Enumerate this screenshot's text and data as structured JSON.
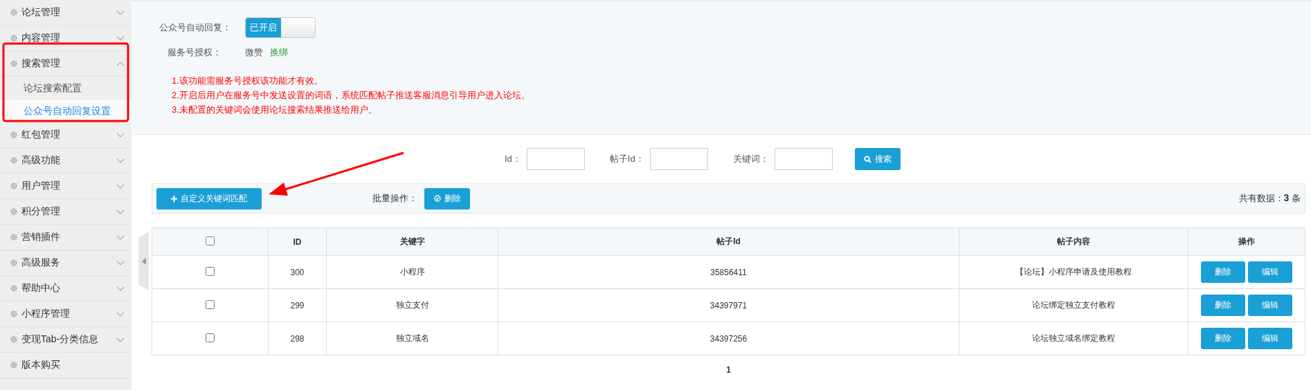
{
  "sidebar": {
    "items": [
      {
        "kind": "menu",
        "label": "论坛管理",
        "expanded": false
      },
      {
        "kind": "menu",
        "label": "内容管理",
        "expanded": false
      },
      {
        "kind": "menu",
        "label": "搜索管理",
        "expanded": true,
        "children": [
          {
            "label": "论坛搜索配置",
            "selected": false
          },
          {
            "label": "公众号自动回复设置",
            "selected": true
          }
        ]
      },
      {
        "kind": "menu",
        "label": "红包管理",
        "expanded": false
      },
      {
        "kind": "menu",
        "label": "高级功能",
        "expanded": false
      },
      {
        "kind": "menu",
        "label": "用户管理",
        "expanded": false
      },
      {
        "kind": "menu",
        "label": "积分管理",
        "expanded": false
      },
      {
        "kind": "menu",
        "label": "营销插件",
        "expanded": false
      },
      {
        "kind": "menu",
        "label": "高级服务",
        "expanded": false
      },
      {
        "kind": "menu",
        "label": "帮助中心",
        "expanded": false
      },
      {
        "kind": "menu",
        "label": "小程序管理",
        "expanded": false
      },
      {
        "kind": "menu",
        "label": "变现Tab-分类信息",
        "expanded": false
      },
      {
        "kind": "link",
        "label": "版本购买"
      }
    ]
  },
  "settings": {
    "auto_reply": {
      "label": "公众号自动回复：",
      "toggle": {
        "text": "已开启",
        "on": true
      }
    },
    "authorization": {
      "label": "服务号授权：",
      "value": "微赞",
      "link": "换绑"
    },
    "notes": [
      "1.该功能需服务号授权该功能才有效。",
      "2.开启后用户在服务号中发送设置的词语，系统匹配帖子推送客服消息引导用户进入论坛。",
      "3.未配置的关键词会使用论坛搜索结果推送给用户。"
    ]
  },
  "search": {
    "fields": [
      {
        "label": "Id："
      },
      {
        "label": "帖子Id："
      },
      {
        "label": "关键词："
      }
    ],
    "button": "搜索"
  },
  "toolbar": {
    "add_button": "自定义关键词匹配",
    "batch_label": "批量操作：",
    "delete_button": "删除",
    "total": {
      "prefix": "共有数据：",
      "count": "3",
      "suffix": "条"
    }
  },
  "table": {
    "header_checked": false,
    "columns": [
      "ID",
      "关键字",
      "帖子Id",
      "帖子内容",
      "操作"
    ],
    "rows": [
      {
        "checked": false,
        "cells": [
          "300",
          "小程序",
          "35856411",
          "【论坛】小程序申请及使用教程"
        ],
        "actions": [
          "删除",
          "编辑"
        ]
      },
      {
        "checked": false,
        "cells": [
          "299",
          "独立支付",
          "34397971",
          "论坛绑定独立支付教程"
        ],
        "actions": [
          "删除",
          "编辑"
        ]
      },
      {
        "checked": false,
        "cells": [
          "298",
          "独立域名",
          "34397256",
          "论坛独立域名绑定教程"
        ],
        "actions": [
          "删除",
          "编辑"
        ]
      }
    ]
  },
  "pagination": {
    "pages": [
      {
        "label": "1",
        "selected": true
      }
    ]
  }
}
